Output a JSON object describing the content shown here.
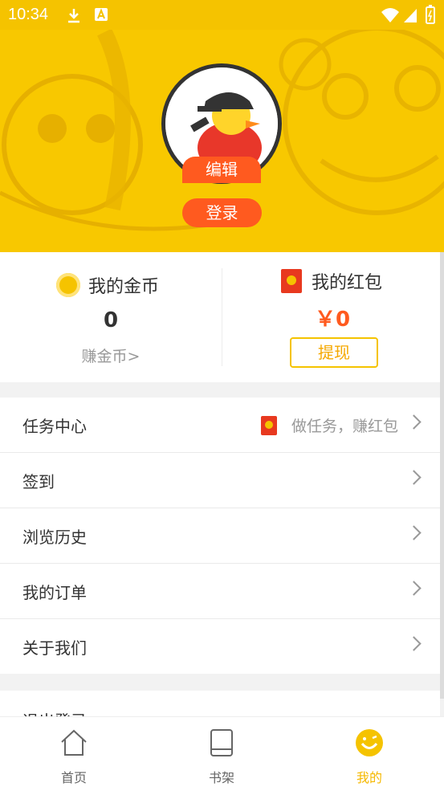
{
  "status_bar": {
    "time": "10:34"
  },
  "profile": {
    "edit_label": "编辑",
    "login_label": "登录"
  },
  "wallet": {
    "coins": {
      "title": "我的金币",
      "value": "0",
      "earn_link": "赚金币>"
    },
    "red_packet": {
      "title": "我的红包",
      "value": "￥0",
      "withdraw_label": "提现"
    }
  },
  "menu": {
    "items": [
      {
        "label": "任务中心",
        "hint": "做任务，赚红包"
      },
      {
        "label": "签到"
      },
      {
        "label": "浏览历史"
      },
      {
        "label": "我的订单"
      },
      {
        "label": "关于我们"
      }
    ]
  },
  "logout": {
    "label": "退出登录"
  },
  "tabs": [
    {
      "label": "首页",
      "icon": "home-icon"
    },
    {
      "label": "书架",
      "icon": "bookshelf-icon"
    },
    {
      "label": "我的",
      "icon": "profile-smile-icon",
      "active": true
    }
  ],
  "colors": {
    "accent": "#f5c300",
    "orange": "#ff5a1f",
    "red_packet": "#e8391f"
  }
}
